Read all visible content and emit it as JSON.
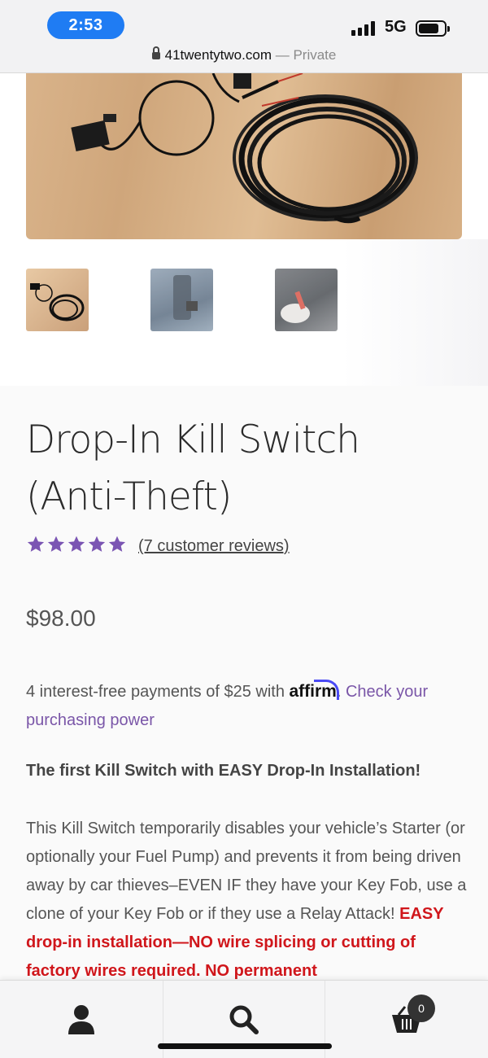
{
  "status_bar": {
    "time": "2:53",
    "network": "5G",
    "url": "41twentytwo.com",
    "separator": " — ",
    "private_label": "Private"
  },
  "gallery": {
    "main_image": "kill-switch-cable-photo",
    "thumbnails": [
      "kill-switch-cable-thumb",
      "car-interior-thumb",
      "fuse-in-hand-thumb"
    ]
  },
  "product": {
    "title": "Drop-In Kill Switch (Anti-Theft)",
    "rating_stars": 5,
    "reviews_link": "(7 customer reviews)",
    "price": "$98.00",
    "affirm_text": "4 interest-free payments of $25 with ",
    "affirm_logo": "affirm",
    "affirm_period": ". ",
    "affirm_link": "Check your purchasing power",
    "headline": "The first Kill Switch with EASY Drop-In Installation!",
    "description_plain": "This Kill Switch temporarily disables your vehicle’s Starter (or optionally your Fuel Pump) and prevents it from being driven away by car thieves–EVEN IF they have your Key Fob, use a clone of your Key Fob or if they use a Relay Attack! ",
    "description_red": "EASY drop-in installation—NO wire splicing or cutting of factory wires required. NO permanent"
  },
  "bottom_nav": {
    "account_icon": "user-icon",
    "search_icon": "search-icon",
    "cart_icon": "cart-icon",
    "cart_count": "0"
  },
  "colors": {
    "accent_blue": "#1f7cf3",
    "star_purple": "#7b55b3",
    "link_purple": "#7a56a8",
    "alert_red": "#d0161b"
  }
}
